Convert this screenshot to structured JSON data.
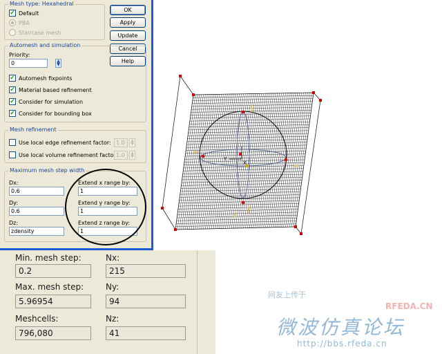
{
  "mesh_type": {
    "title": "Mesh type: Hexahedral",
    "default_label": "Default",
    "default_checked": true,
    "pba_label": "PBA",
    "staircase_label": "Staircase mesh"
  },
  "buttons": {
    "ok": "OK",
    "apply": "Apply",
    "update": "Update",
    "cancel": "Cancel",
    "help": "Help"
  },
  "automesh": {
    "title": "Automesh and simulation",
    "priority_label": "Priority:",
    "priority_value": "0",
    "fixpoints_label": "Automesh fixpoints",
    "fixpoints_checked": true,
    "material_label": "Material based refinement",
    "material_checked": true,
    "simulation_label": "Consider for simulation",
    "simulation_checked": true,
    "bounding_label": "Consider for bounding box",
    "bounding_checked": true
  },
  "refinement": {
    "title": "Mesh refinement",
    "edge_label": "Use local edge refinement factor:",
    "edge_value": "1.0",
    "volume_label": "Use local volume refinement factor:",
    "volume_value": "1.0"
  },
  "step_width": {
    "title": "Maximum mesh step width",
    "dx_label": "Dx:",
    "dx_value": "0.6",
    "dy_label": "Dy:",
    "dy_value": "0.6",
    "dz_label": "Dz:",
    "dz_value": "zdensity",
    "extend_x_label": "Extend x range by:",
    "extend_x_value": "1",
    "extend_y_label": "Extend y range by:",
    "extend_y_value": "1",
    "extend_z_label": "Extend z range by:",
    "extend_z_value": "1"
  },
  "stats": {
    "min_step_label": "Min. mesh step:",
    "min_step_value": "0.2",
    "nx_label": "Nx:",
    "nx_value": "215",
    "max_step_label": "Max. mesh step:",
    "max_step_value": "5.96954",
    "ny_label": "Ny:",
    "ny_value": "94",
    "meshcells_label": "Meshcells:",
    "meshcells_value": "796,080",
    "nz_label": "Nz:",
    "nz_value": "41"
  },
  "viewport": {
    "axis_y_label": "Y",
    "axis_x_label": "X"
  },
  "watermark": {
    "small_text": "网友上传于",
    "brand_text": "RFEDA.CN",
    "big_text": "微波仿真论坛",
    "url_text": "http://bbs.rfeda.cn"
  },
  "colors": {
    "accent_border": "#1d5ad6",
    "group_title": "#1846a0",
    "dialog_bg": "#ece9d8",
    "mesh_corner": "#cc0000",
    "mesh_tick": "#f0c020"
  }
}
